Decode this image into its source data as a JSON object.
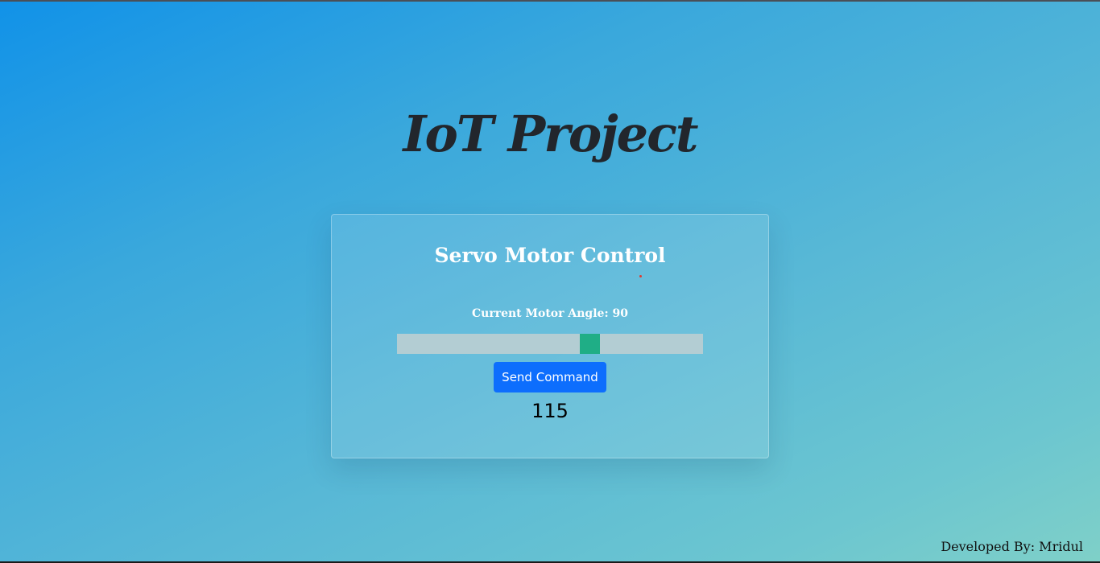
{
  "page": {
    "title": "IoT Project"
  },
  "card": {
    "title": "Servo Motor Control",
    "angle_label": "Current Motor Angle: 90",
    "slider": {
      "min": 0,
      "max": 180,
      "value": 115
    },
    "send_button_label": "Send Command",
    "value_display": "115"
  },
  "footer": {
    "text": "Developed By: Mridul"
  },
  "colors": {
    "accent": "#0d6efd",
    "slider_thumb": "#1fae86",
    "slider_track": "#b3cdd3",
    "title_text": "#22262c"
  }
}
